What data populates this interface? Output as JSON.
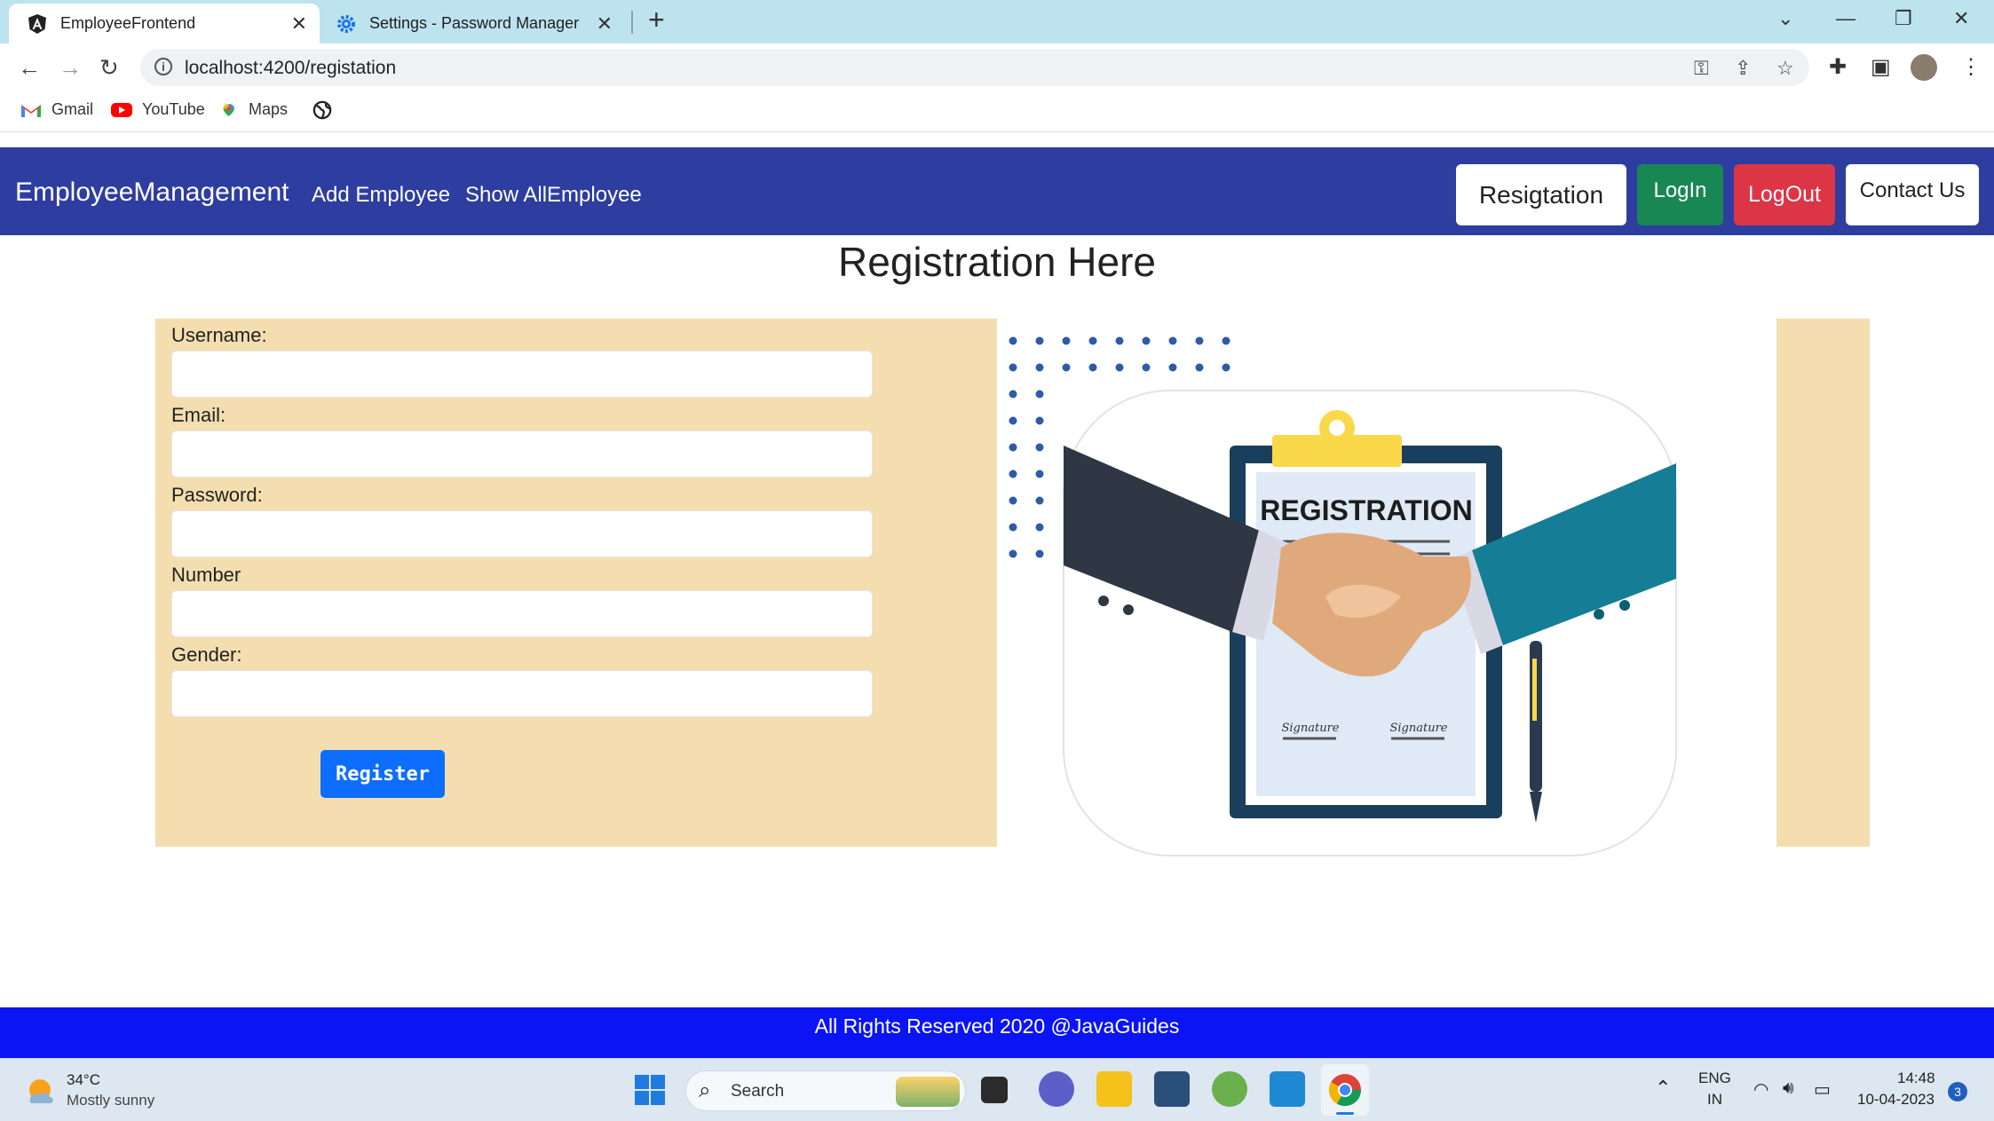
{
  "browser": {
    "tabs": [
      {
        "title": "EmployeeFrontend",
        "icon": "angular-icon",
        "active": true
      },
      {
        "title": "Settings - Password Manager",
        "icon": "gear-icon",
        "active": false
      }
    ],
    "new_tab": "+",
    "url": "localhost:4200/registation",
    "bookmarks": [
      {
        "label": "Gmail",
        "icon": "gmail-icon"
      },
      {
        "label": "YouTube",
        "icon": "youtube-icon"
      },
      {
        "label": "Maps",
        "icon": "maps-icon"
      },
      {
        "label": "",
        "icon": "globe-icon"
      }
    ]
  },
  "navbar": {
    "brand": "EmployeeManagement",
    "links": [
      "Add Employee",
      "Show AllEmployee"
    ],
    "buttons": {
      "registration": "Resigtation",
      "login": "LogIn",
      "logout": "LogOut",
      "contact": "Contact Us"
    },
    "colors": {
      "background": "#2e3da0",
      "login": "#198754",
      "logout": "#dc3545"
    }
  },
  "page": {
    "title": "Registration Here",
    "form": {
      "fields": [
        {
          "label": "Username:",
          "value": ""
        },
        {
          "label": "Email:",
          "value": ""
        },
        {
          "label": "Password:",
          "value": ""
        },
        {
          "label": "Number",
          "value": ""
        },
        {
          "label": "Gender:",
          "value": ""
        }
      ],
      "submit": "Register"
    },
    "illustration": {
      "heading": "REGISTRATION",
      "signature_1": "Signature",
      "signature_2": "Signature"
    }
  },
  "footer": {
    "text": "All Rights Reserved 2020 @JavaGuides"
  },
  "taskbar": {
    "weather_temp": "34°C",
    "weather_desc": "Mostly sunny",
    "search_label": "Search",
    "lang": "ENG",
    "region": "IN",
    "time": "14:48",
    "date": "10-04-2023",
    "notification_count": "3"
  }
}
